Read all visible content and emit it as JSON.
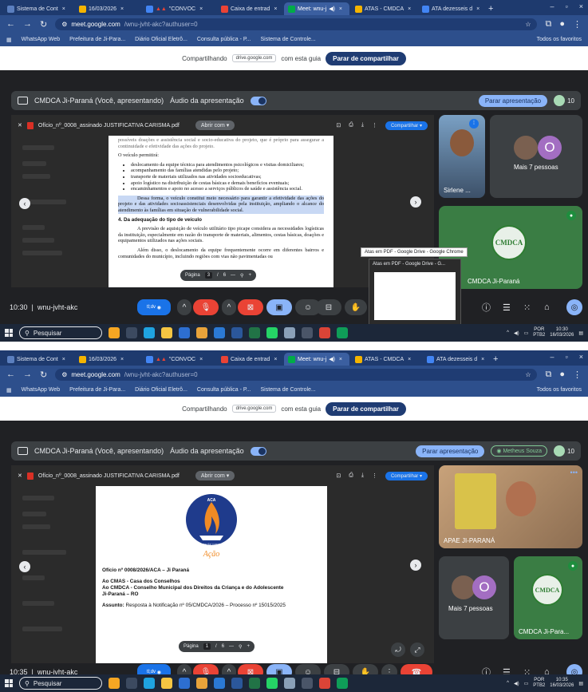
{
  "screenshots": [
    {
      "tabs": [
        {
          "label": "Sistema de Cont",
          "icon": "globe-icon"
        },
        {
          "label": "16/03/2026",
          "icon": "drive-icon"
        },
        {
          "label": "\"CONVOC",
          "icon": "doc-icon"
        },
        {
          "label": "Caixa de entrad",
          "icon": "gmail-icon"
        },
        {
          "label": "Meet: wnu-j",
          "icon": "meet-icon",
          "active": true
        },
        {
          "label": "ATAS - CMDCA",
          "icon": "drive-icon"
        },
        {
          "label": "ATA dezesseis d",
          "icon": "doc-icon"
        }
      ],
      "url": {
        "host": "meet.google.com",
        "path": "/wnu-jvht-akc?authuser=0"
      },
      "bookmarks": [
        "WhatsApp Web",
        "Prefeitura de Ji-Para...",
        "Diário Oficial Eletrô...",
        "Consulta pública - P...",
        "Sistema de Controle..."
      ],
      "bookmarks_right": "Todos os favoritos",
      "sharing": {
        "text1": "Compartilhando",
        "chip": "drive.google.com",
        "text2": "com esta guia",
        "stop": "Parar de compartilhar"
      },
      "presentation": {
        "title": "CMDCA Ji-Paraná (Você, apresentando)",
        "audio": "Áudio da apresentação",
        "stop": "Parar apresentação",
        "speaker": "",
        "participants": "10"
      },
      "viewer": {
        "filename": "Ofício_nº_0008_assinado JUSTIFICATIVA CARISMA.pdf",
        "open_with": "Abrir com",
        "share": "Compartilhar",
        "page_label": "Página",
        "page_current": "3",
        "page_total": "6",
        "doc": {
          "p0": "possíveis doações e assistência social e socio-educativa do projeto, que é próprio para assegurar a continuidade e efetividade das ações do projeto.",
          "p1": "O veículo permitirá:",
          "bullets": [
            "deslocamento da equipe técnica para atendimentos psicológicos e visitas domiciliares;",
            "acompanhamento das famílias atendidas pelo projeto;",
            "transporte de materiais utilizados nas atividades socioeducativas;",
            "apoio logístico na distribuição de cestas básicas e demais benefícios eventuais;",
            "encaminhamentos e apoio no acesso a serviços públicos de saúde e assistência social."
          ],
          "p2": "Dessa forma, o veículo constitui meio necessário para garantir a efetividade das ações do projeto e das atividades socioassistenciais desenvolvidas pela instituição, ampliando o alcance do atendimento às famílias em situação de vulnerabilidade social.",
          "h": "4. Da adequação do tipo de veículo",
          "p3": "A previsão de aquisição de veículo utilitário tipo picape considera as necessidades logísticas da instituição, especialmente em razão do transporte de materiais, alimentos, cestas básicas, doações e equipamentos utilizados nas ações sociais.",
          "p4": "Além disso, o deslocamento da equipe frequentemente ocorre em diferentes bairros e comunidades do município, incluindo regiões com vias não pavimentadas ou"
        }
      },
      "tiles": [
        {
          "name": "Sirlene ..."
        },
        {
          "name": "Mais 7 pessoas",
          "avatar_letter": "O"
        },
        {
          "name": "CMDCA Ji-Paraná",
          "logo": "CMDCA"
        }
      ],
      "popup": {
        "title": "Atas em PDF - Google Drive - Google Chrome",
        "thumb_title": "Atas em PDF - Google Drive - G..."
      },
      "controls": {
        "time": "10:30",
        "meeting": "wnu-jvht-akc",
        "pill": "tl;dv"
      },
      "taskbar": {
        "search": "Pesquisar",
        "lang": "POR",
        "lang2": "PTB2",
        "time": "10:30",
        "date": "16/03/2026"
      }
    },
    {
      "tabs": [
        {
          "label": "Sistema de Cont",
          "icon": "globe-icon"
        },
        {
          "label": "16/03/2026",
          "icon": "drive-icon"
        },
        {
          "label": "\"CONVOC",
          "icon": "doc-icon"
        },
        {
          "label": "Caixa de entrad",
          "icon": "gmail-icon"
        },
        {
          "label": "Meet: wnu-j",
          "icon": "meet-icon",
          "active": true
        },
        {
          "label": "ATAS - CMDCA",
          "icon": "drive-icon"
        },
        {
          "label": "ATA dezesseis d",
          "icon": "doc-icon"
        }
      ],
      "url": {
        "host": "meet.google.com",
        "path": "/wnu-jvht-akc?authuser=0"
      },
      "bookmarks": [
        "WhatsApp Web",
        "Prefeitura de Ji-Para...",
        "Diário Oficial Eletrô...",
        "Consulta pública - P...",
        "Sistema de Controle..."
      ],
      "bookmarks_right": "Todos os favoritos",
      "sharing": {
        "text1": "Compartilhando",
        "chip": "drive.google.com",
        "text2": "com esta guia",
        "stop": "Parar de compartilhar"
      },
      "presentation": {
        "title": "CMDCA Ji-Paraná (Você, apresentando)",
        "audio": "Áudio da apresentação",
        "stop": "Parar apresentação",
        "speaker": "Metheus Souza",
        "participants": "10"
      },
      "viewer": {
        "filename": "Ofício_nº_0008_assinado JUSTIFICATIVA CARISMA.pdf",
        "open_with": "Abrir com",
        "share": "Compartilhar",
        "page_label": "Página",
        "page_current": "1",
        "page_total": "6",
        "doc": {
          "logo_top": "ACA",
          "logo_bottom": "ASSOCIAÇÃO CARISMA EM",
          "logo_script": "Ação",
          "l1": "Ofício nº 0008/2026/ACA – Ji Paraná",
          "l2": "Ao CMAS - Casa dos Conselhos",
          "l3": "Ao CMDCA - Conselho Municipal dos Direitos da Criança e do Adolescente",
          "l4": "Ji-Paraná – RO",
          "l5a": "Assunto:",
          "l5b": " Resposta à Notificação nº 05/CMDCA/2026 – Processo nº 15015/2025"
        }
      },
      "tiles": [
        {
          "name": "APAE JI-PARANÁ"
        },
        {
          "name": "Mais 7 pessoas",
          "avatar_letter": "O"
        },
        {
          "name": "CMDCA Ji-Para...",
          "logo": "CMDCA"
        }
      ],
      "controls": {
        "time": "10:35",
        "meeting": "wnu-jvht-akc",
        "pill": "tl;dv"
      },
      "taskbar": {
        "search": "Pesquisar",
        "lang": "POR",
        "lang2": "PTB2",
        "time": "10:35",
        "date": "16/03/2026"
      }
    }
  ],
  "colors": {
    "chrome_dark": "#1e3a6e",
    "meet_bg": "#202124",
    "accent_blue": "#8ab4f8",
    "end_call_red": "#ea4335",
    "green": "#81c995"
  }
}
